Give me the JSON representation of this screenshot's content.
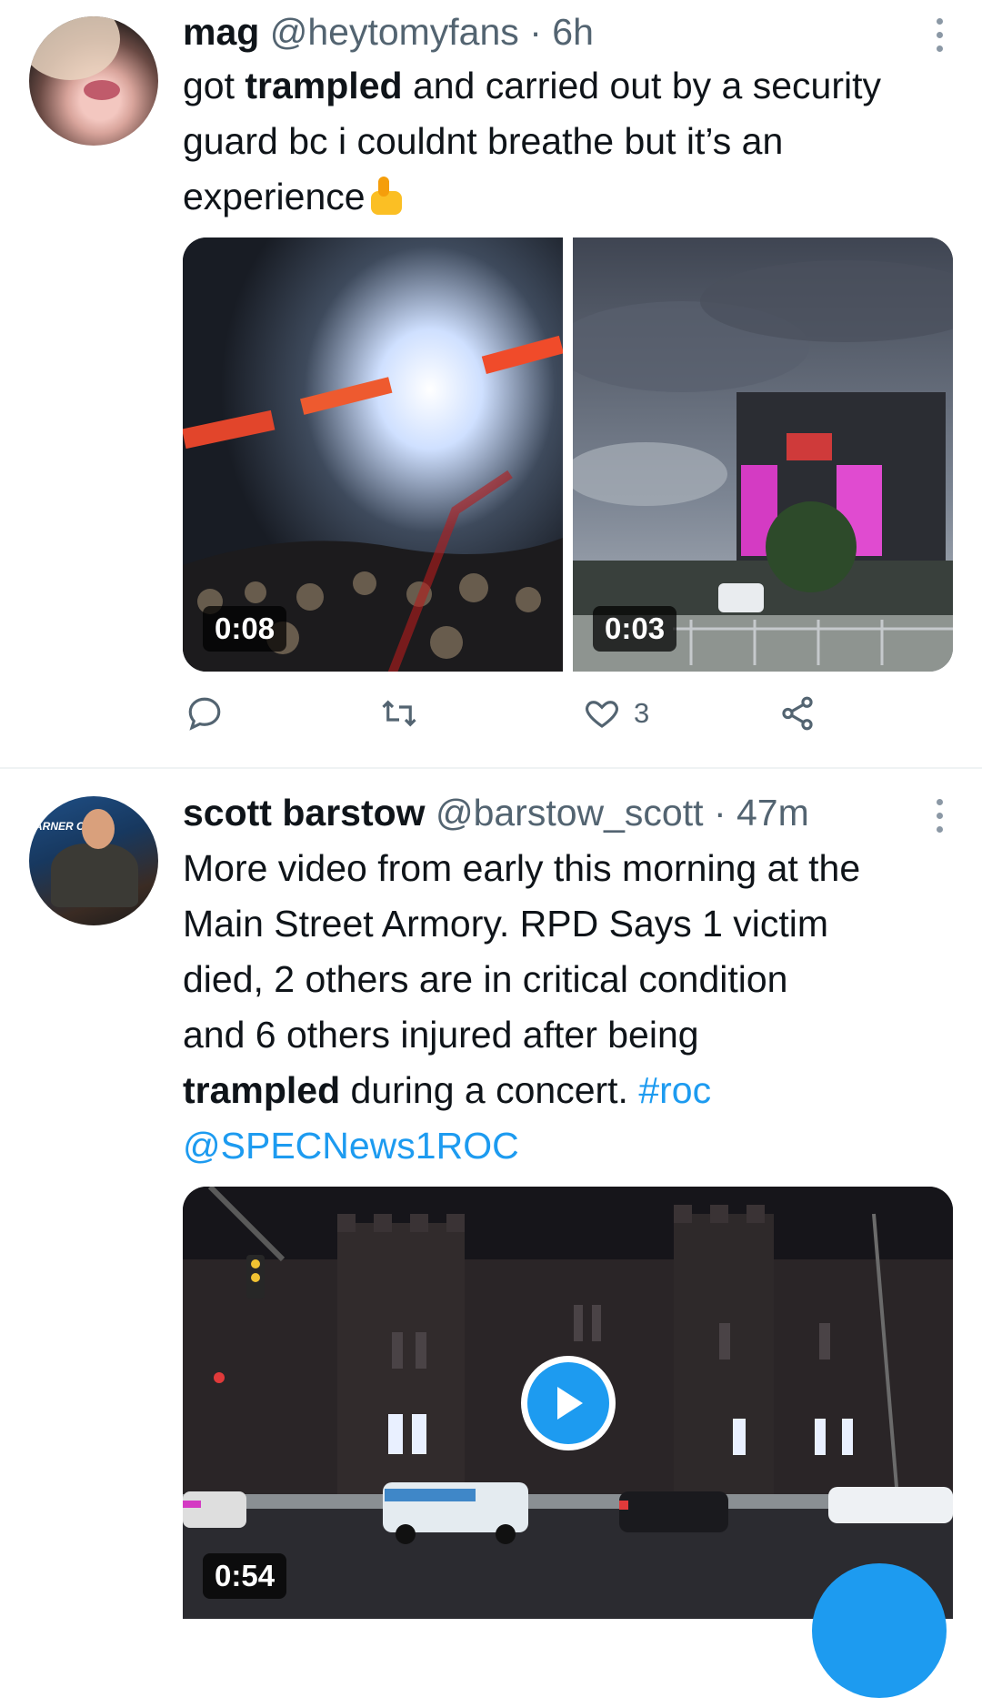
{
  "tweets": [
    {
      "display_name": "mag",
      "handle": "@heytomyfans",
      "separator": "·",
      "time": "6h",
      "text_parts": [
        {
          "text": "got ",
          "bold": false
        },
        {
          "text": "trampled",
          "bold": true
        },
        {
          "text": " and carried out by a security guard bc i couldnt breathe but it’s an experience",
          "bold": false
        }
      ],
      "emoji": "thumbs-up",
      "media": [
        {
          "type": "video",
          "duration": "0:08",
          "description": "concert-crowd-stage-lights"
        },
        {
          "type": "video",
          "duration": "0:03",
          "description": "stage-structure-pink-screens"
        }
      ],
      "actions": {
        "reply_count": "",
        "retweet_count": "",
        "like_count": "3",
        "share_label": ""
      }
    },
    {
      "display_name": "scott barstow",
      "handle": "@barstow_scott",
      "separator": "·",
      "time": "47m",
      "avatar_text": "ARNER CA",
      "text_line1": "More video from early this morning at the",
      "text_line2": "Main Street Armory.  RPD Says 1 victim",
      "text_line3": "died, 2 others are in critical condition",
      "text_line4": "and 6 others injured after being",
      "text_bold": "trampled",
      "text_after_bold": " during a concert. ",
      "hashtag": "#roc",
      "mention": "@SPECNews1ROC",
      "media": [
        {
          "type": "video",
          "duration": "0:54",
          "description": "night-armory-building-police-vehicles"
        }
      ]
    }
  ],
  "colors": {
    "link": "#1d9bf0",
    "secondary_text": "#536471",
    "divider": "#eff3f4"
  }
}
